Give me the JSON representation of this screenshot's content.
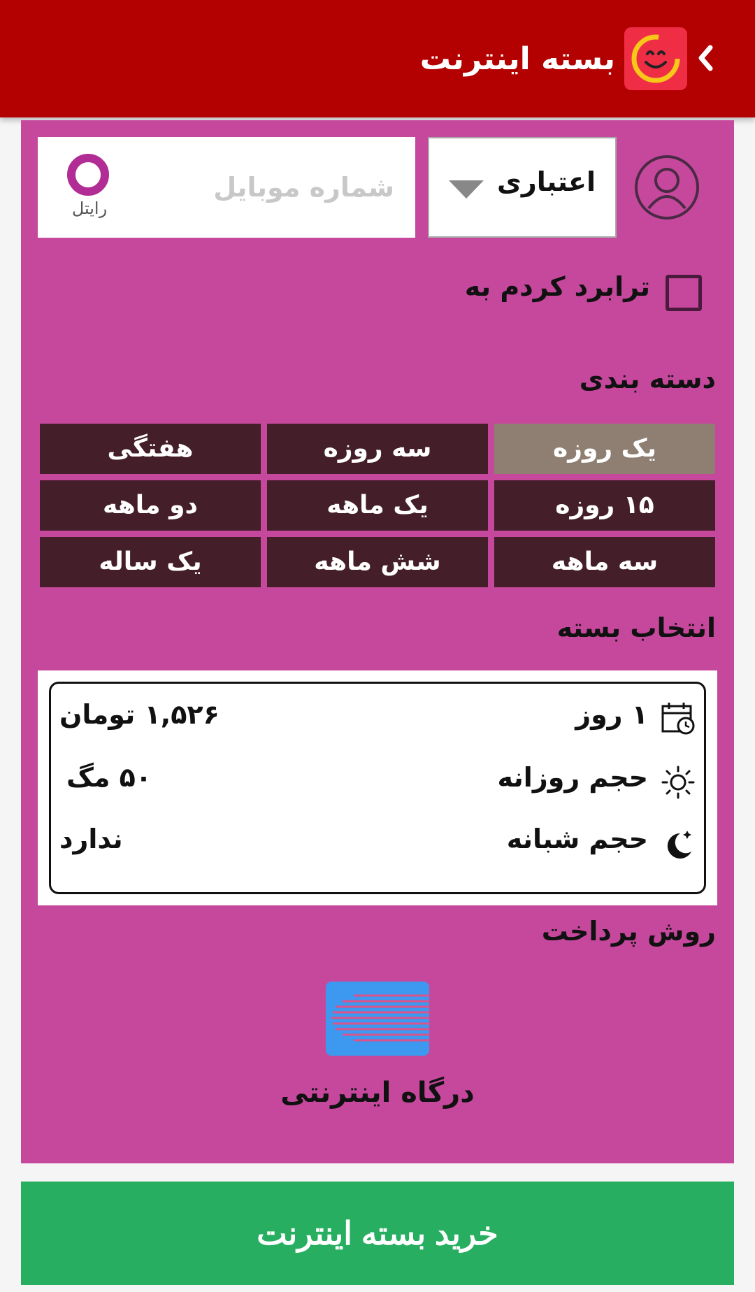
{
  "header": {
    "title": "بسته اینترنت"
  },
  "form": {
    "sim_type": "اعتباری",
    "phone_placeholder": "شماره موبایل",
    "operator_name": "رایتل",
    "transfer_label": "ترابرد کردم به"
  },
  "categories": {
    "title": "دسته بندی",
    "items": [
      {
        "label": "یک روزه",
        "selected": true
      },
      {
        "label": "سه روزه",
        "selected": false
      },
      {
        "label": "هفتگی",
        "selected": false
      },
      {
        "label": "۱۵ روزه",
        "selected": false
      },
      {
        "label": "یک ماهه",
        "selected": false
      },
      {
        "label": "دو ماهه",
        "selected": false
      },
      {
        "label": "سه ماهه",
        "selected": false
      },
      {
        "label": "شش ماهه",
        "selected": false
      },
      {
        "label": "یک ساله",
        "selected": false
      }
    ]
  },
  "package": {
    "title": "انتخاب بسته",
    "duration": "۱ روز",
    "price": "۱,۵۲۶ تومان",
    "daily_label": "حجم روزانه",
    "daily_value": "۵۰ مگ",
    "night_label": "حجم شبانه",
    "night_value": "ندارد"
  },
  "payment": {
    "title": "روش پرداخت",
    "gateway_label": "درگاه اینترنتی"
  },
  "buy_button": "خرید بسته اینترنت",
  "colors": {
    "appbar": "#b30000",
    "panel": "#c6489d",
    "category": "#441e28",
    "category_selected": "#8e7f72",
    "buy": "#27ae60"
  },
  "icons": [
    "back-chevron-icon",
    "app-logo-icon",
    "user-avatar-icon",
    "dropdown-arrow-icon",
    "operator-logo-icon",
    "calendar-clock-icon",
    "sun-icon",
    "moon-stars-icon",
    "card-gateway-icon"
  ]
}
